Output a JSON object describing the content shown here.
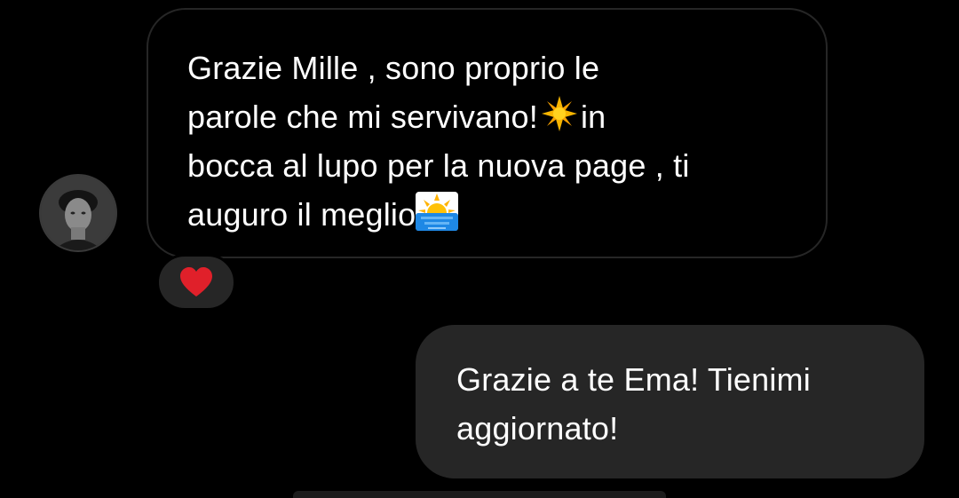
{
  "conversation": {
    "incoming": {
      "line1": "Grazie Mille , sono proprio le",
      "line2_before": "parole che mi servivano!",
      "line2_emoji": "sparkle-emoji",
      "line2_after": "in",
      "line3": "bocca al lupo per la nuova page , ti",
      "line4_before": "auguro il meglio",
      "line4_emoji": "sunrise-emoji",
      "reaction": "❤"
    },
    "outgoing": {
      "line1": "Grazie a te Ema! Tienimi",
      "line2": "aggiornato!"
    }
  },
  "colors": {
    "background": "#000000",
    "bubble_outgoing": "#262626",
    "bubble_incoming_border": "#262626",
    "reaction_heart": "#e0202a",
    "text": "#ffffff"
  }
}
